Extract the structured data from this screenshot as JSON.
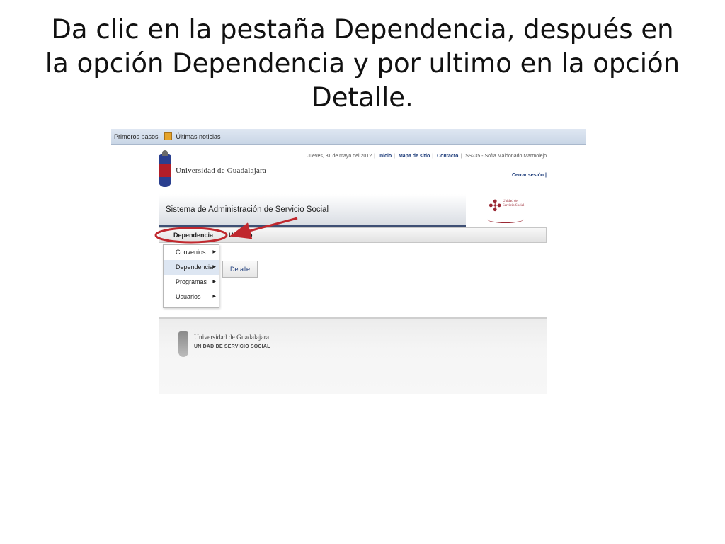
{
  "slide": {
    "title_lines": [
      "Da clic en la pestaña Dependencia, después en",
      "la opción Dependencia y por ultimo en la opción",
      "Detalle."
    ]
  },
  "browser": {
    "bookmarks": [
      "Primeros pasos",
      "Últimas noticias"
    ]
  },
  "header": {
    "date": "Jueves, 31 de mayo del 2012",
    "links": [
      "Inicio",
      "Mapa de sitio",
      "Contacto"
    ],
    "user": "SS235 - Sofía Maldonado Marmolejo",
    "logout": "Cerrar sesión",
    "university": "Universidad de Guadalajara",
    "system_title": "Sistema de Administración de Servicio Social",
    "uss_logo_text": [
      "Unidad de",
      "Servicio Social"
    ]
  },
  "menu": {
    "tabs": [
      "Dependencia",
      "Usuario"
    ],
    "dropdown_items": [
      "Convenios",
      "Dependencia",
      "Programas",
      "Usuarios"
    ],
    "active_item": "Dependencia",
    "submenu_item": "Detalle"
  },
  "footer": {
    "university": "Universidad de Guadalajara",
    "unit": "UNIDAD DE SERVICIO SOCIAL"
  },
  "colors": {
    "annotation": "#c0282e",
    "link": "#1d3c7a",
    "banner_rule": "#3e4f74"
  },
  "icons": [
    "bookmark-folder-icon",
    "udg-seal-icon",
    "uss-logo-icon",
    "submenu-arrow-icon"
  ]
}
